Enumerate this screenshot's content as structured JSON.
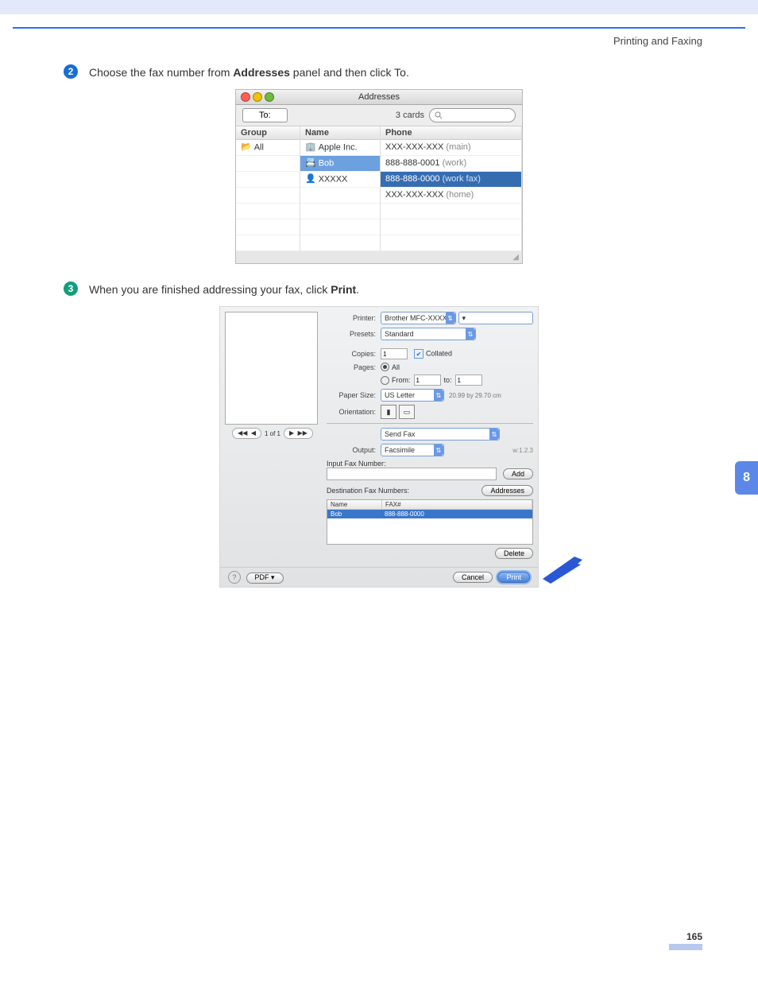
{
  "header": {
    "section_title": "Printing and Faxing"
  },
  "steps": [
    {
      "badge": "2",
      "badge_class": "b-blue",
      "parts": [
        "Choose the fax number from ",
        "Addresses",
        " panel and then click To."
      ],
      "bold": 1
    },
    {
      "badge": "3",
      "badge_class": "b-teal",
      "parts": [
        "When you are finished addressing your fax, click ",
        "Print",
        "."
      ],
      "bold": 1
    }
  ],
  "addresses": {
    "title": "Addresses",
    "to_button": "To:",
    "card_count": "3 cards",
    "columns": [
      "Group",
      "Name",
      "Phone"
    ],
    "groups": [
      {
        "label": "All",
        "selected": false
      }
    ],
    "names": [
      {
        "label": "Apple Inc.",
        "icon": "building"
      },
      {
        "label": "Bob",
        "icon": "card",
        "selected": true
      },
      {
        "label": "XXXXX",
        "icon": "person"
      }
    ],
    "phones": [
      {
        "number": "XXX-XXX-XXX",
        "type": "(main)"
      },
      {
        "number": "888-888-0001",
        "type": "(work)"
      },
      {
        "number": "888-888-0000",
        "type": "(work fax)",
        "selected": true
      },
      {
        "number": "XXX-XXX-XXX",
        "type": "(home)"
      }
    ]
  },
  "print": {
    "nav": "1 of 1",
    "printer_label": "Printer:",
    "printer_value": "Brother MFC-XXXX",
    "presets_label": "Presets:",
    "presets_value": "Standard",
    "copies_label": "Copies:",
    "copies_value": "1",
    "collated_label": "Collated",
    "pages_label": "Pages:",
    "pages_all": "All",
    "pages_from": "From:",
    "pages_from_value": "1",
    "pages_to": "to:",
    "pages_to_value": "1",
    "paper_label": "Paper Size:",
    "paper_value": "US Letter",
    "paper_dims": "20.99 by 29.70 cm",
    "orient_label": "Orientation:",
    "feature_value": "Send Fax",
    "output_label": "Output:",
    "output_value": "Facsimile",
    "version": "w:1.2.3",
    "input_label": "Input Fax Number:",
    "add_btn": "Add",
    "dest_label": "Destination Fax Numbers:",
    "addr_btn": "Addresses",
    "dest_cols": [
      "Name",
      "FAX#"
    ],
    "dest_rows": [
      {
        "name": "Bob",
        "fax": "888-888-0000"
      }
    ],
    "delete_btn": "Delete",
    "pdf_btn": "PDF ▾",
    "cancel_btn": "Cancel",
    "print_btn": "Print"
  },
  "side_tab": "8",
  "page_number": "165"
}
